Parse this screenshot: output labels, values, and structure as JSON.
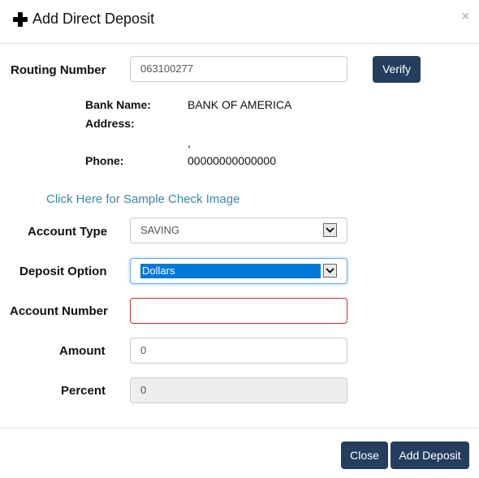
{
  "dialog": {
    "title": "Add Direct Deposit",
    "close_glyph": "×"
  },
  "routing": {
    "label": "Routing Number",
    "value": "063100277",
    "verify_label": "Verify"
  },
  "bank_info": {
    "bank_name_label": "Bank Name:",
    "bank_name_value": "BANK OF AMERICA",
    "address_label": "Address:",
    "address_value": ",",
    "phone_label": "Phone:",
    "phone_value": "00000000000000"
  },
  "sample_check_link": "Click Here for Sample Check Image",
  "fields": {
    "account_type": {
      "label": "Account Type",
      "value": "SAVING"
    },
    "deposit_option": {
      "label": "Deposit Option",
      "value": "Dollars"
    },
    "account_number": {
      "label": "Account Number",
      "value": ""
    },
    "amount": {
      "label": "Amount",
      "value": "0"
    },
    "percent": {
      "label": "Percent",
      "value": "0"
    }
  },
  "footer": {
    "close_label": "Close",
    "add_label": "Add Deposit"
  }
}
